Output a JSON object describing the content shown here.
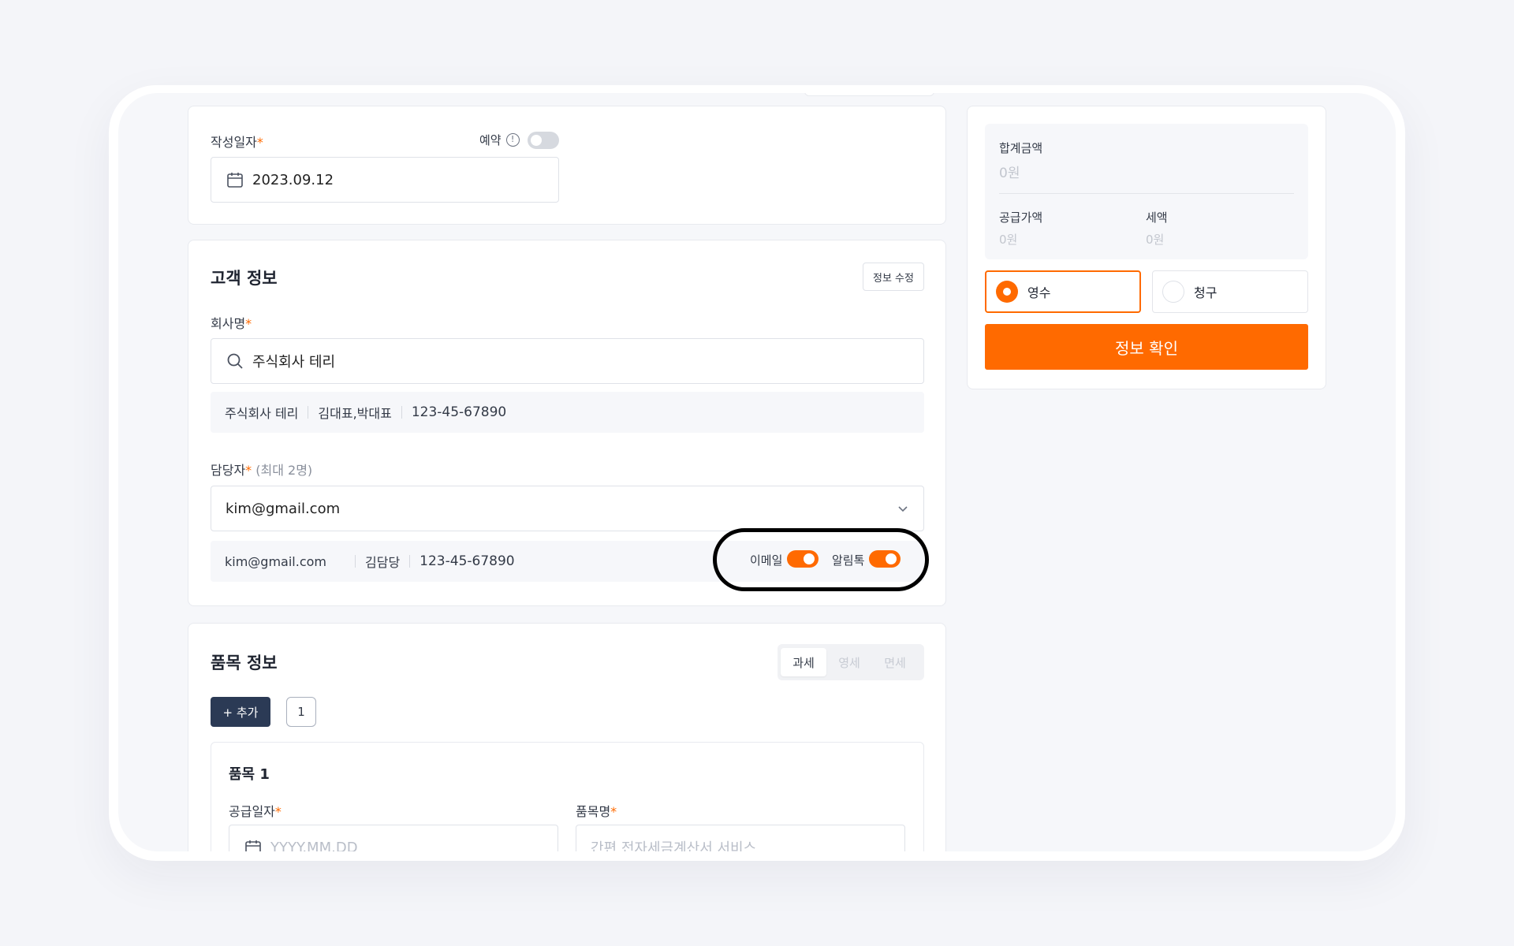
{
  "date_section": {
    "label": "작성일자",
    "required_mark": "*",
    "reserve_label": "예약",
    "reserve_toggle": "off",
    "date_value": "2023.09.12"
  },
  "customer": {
    "title": "고객 정보",
    "edit_button": "정보 수정",
    "company_label": "회사명",
    "required_mark": "*",
    "company_value": "주식회사 테리",
    "company_info": {
      "name": "주식회사 테리",
      "reps": "김대표,박대표",
      "biz_no": "123-45-67890"
    },
    "manager_label": "담당자",
    "manager_limit": "(최대 2명)",
    "manager_value": "kim@gmail.com",
    "manager_info": {
      "email": "kim@gmail.com",
      "name": "김담당",
      "phone": "123-45-67890",
      "email_toggle_label": "이메일",
      "email_toggle": "on",
      "alimtalk_toggle_label": "알림톡",
      "alimtalk_toggle": "on"
    }
  },
  "items": {
    "title": "품목 정보",
    "tax_tabs": [
      "과세",
      "영세",
      "면세"
    ],
    "tax_selected": "과세",
    "add_button": "+ 추가",
    "count": "1",
    "item_title": "품목 1",
    "supply_date_label": "공급일자",
    "supply_date_placeholder": "YYYY.MM.DD",
    "item_name_label": "품목명",
    "item_name_placeholder": "간편 전자세금계산서 서비스",
    "required_mark": "*"
  },
  "summary": {
    "total_label": "합계금액",
    "total_value": "0원",
    "supply_label": "공급가액",
    "supply_value": "0원",
    "tax_label": "세액",
    "tax_value": "0원",
    "receipt_option": "영수",
    "claim_option": "청구",
    "selected_option": "영수",
    "confirm_button": "정보 확인"
  },
  "colors": {
    "accent": "#ff6a00",
    "navy_button": "#2b3a55",
    "highlight_ring": "#000000"
  }
}
